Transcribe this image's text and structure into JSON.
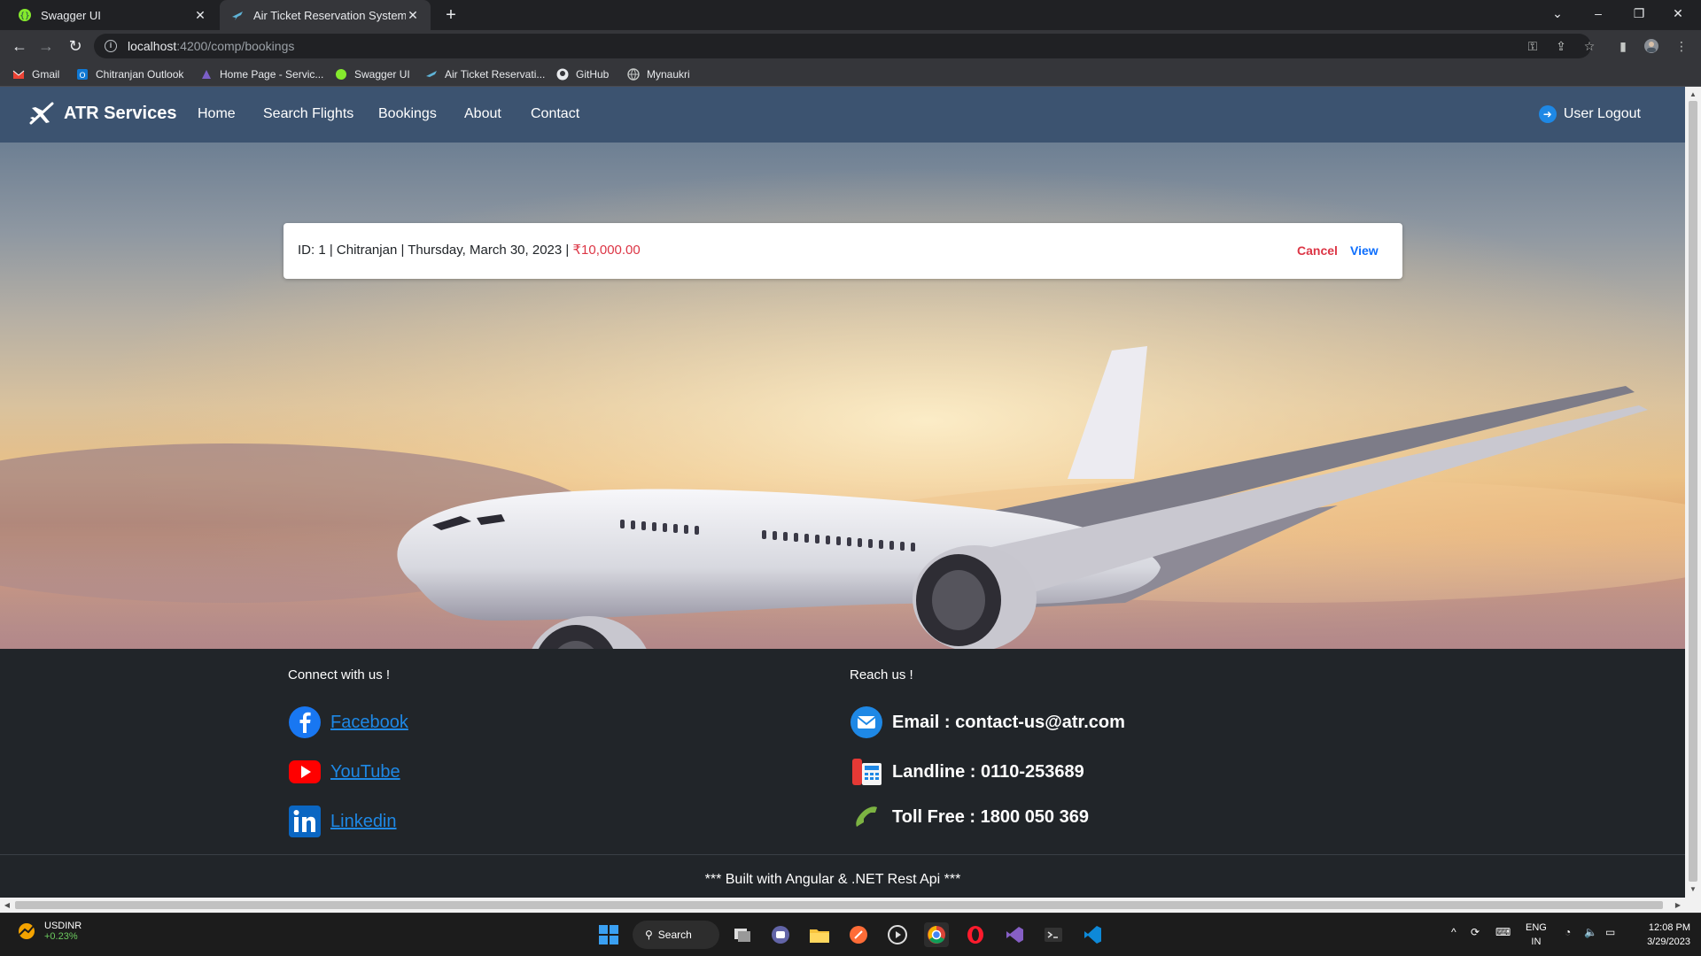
{
  "browser": {
    "tabs": [
      {
        "title": "Swagger UI",
        "active": false
      },
      {
        "title": "Air Ticket Reservation System",
        "active": true
      }
    ],
    "url_host": "localhost",
    "url_path": ":4200/comp/bookings",
    "bookmarks": [
      "Gmail",
      "Chitranjan Outlook",
      "Home Page - Servic...",
      "Swagger UI",
      "Air Ticket Reservati...",
      "GitHub",
      "Mynaukri"
    ]
  },
  "navbar": {
    "brand": "ATR Services",
    "links": [
      "Home",
      "Search Flights",
      "Bookings",
      "About",
      "Contact"
    ],
    "logout": "User Logout"
  },
  "booking": {
    "summary": "ID: 1 | Chitranjan | Thursday, March 30, 2023 |",
    "price": "₹10,000.00",
    "cancel_label": "Cancel",
    "view_label": "View"
  },
  "footer": {
    "connect_heading": "Connect with us !",
    "reach_heading": "Reach us !",
    "social": [
      "Facebook",
      "YouTube",
      "Linkedin"
    ],
    "contacts": [
      "Email : contact-us@atr.com",
      "Landline : 0110-253689",
      "Toll Free : 1800 050 369"
    ],
    "built_with": "*** Built with Angular & .NET Rest Api ***"
  },
  "taskbar": {
    "ticker_symbol": "USDINR",
    "ticker_change": "+0.23%",
    "search_label": "Search",
    "lang_top": "ENG",
    "lang_bottom": "IN",
    "time": "12:08 PM",
    "date": "3/29/2023"
  },
  "colors": {
    "navbar": "#3c5370",
    "footer": "#212529",
    "price": "#dc3545",
    "link": "#0d6efd"
  }
}
